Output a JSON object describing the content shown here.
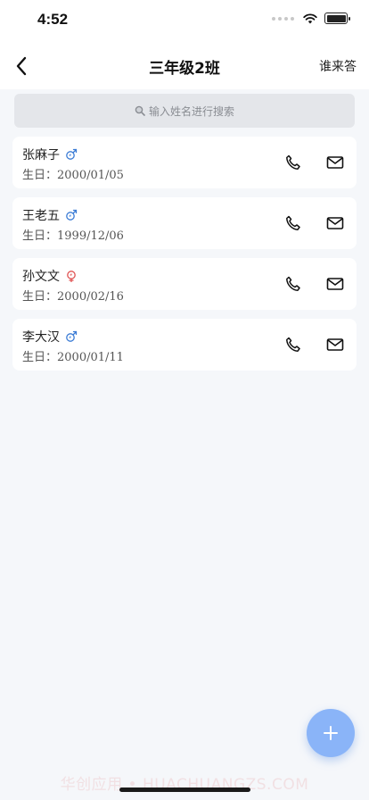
{
  "status_bar": {
    "time": "4:52"
  },
  "nav": {
    "title": "三年级2班",
    "right_action": "谁来答"
  },
  "search": {
    "placeholder": "输入姓名进行搜索"
  },
  "students": [
    {
      "name": "张麻子",
      "gender": "male",
      "birth_label": "生日：",
      "birth_date": "2000/01/05"
    },
    {
      "name": "王老五",
      "gender": "male",
      "birth_label": "生日：",
      "birth_date": "1999/12/06"
    },
    {
      "name": "孙文文",
      "gender": "female",
      "birth_label": "生日：",
      "birth_date": "2000/02/16"
    },
    {
      "name": "李大汉",
      "gender": "male",
      "birth_label": "生日：",
      "birth_date": "2000/01/11"
    }
  ],
  "icons": {
    "back": "chevron-left-icon",
    "search": "search-icon",
    "male": "male-icon",
    "female": "female-icon",
    "phone": "phone-icon",
    "mail": "mail-icon",
    "add": "plus-icon"
  },
  "colors": {
    "male": "#3a7bd5",
    "female": "#e05252",
    "fab": "#8ab4f8",
    "background": "#f5f7fa"
  },
  "watermark": "华创应用 • HUACHUANGZS.COM"
}
